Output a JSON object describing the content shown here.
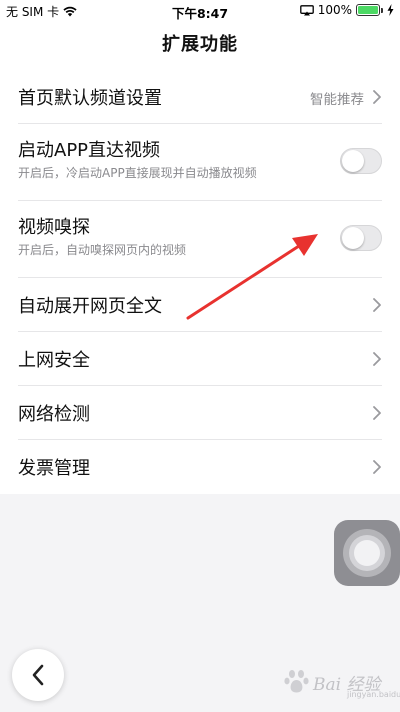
{
  "status_bar": {
    "carrier": "无 SIM 卡",
    "time": "下午8:47",
    "battery_percent": "100%",
    "battery_level": 1.0,
    "battery_color": "#4cd964"
  },
  "header": {
    "title": "扩展功能"
  },
  "settings": {
    "items": [
      {
        "title": "首页默认频道设置",
        "value": "智能推荐",
        "control": "chevron-right-icon"
      },
      {
        "title": "启动APP直达视频",
        "subtitle": "开启后，冷启动APP直接展现并自动播放视频",
        "control": "toggle",
        "enabled": false
      },
      {
        "title": "视频嗅探",
        "subtitle": "开启后，自动嗅探网页内的视频",
        "control": "toggle",
        "enabled": false
      },
      {
        "title": "自动展开网页全文",
        "control": "chevron-right-icon"
      },
      {
        "title": "上网安全",
        "control": "chevron-right-icon"
      },
      {
        "title": "网络检测",
        "control": "chevron-right-icon"
      },
      {
        "title": "发票管理",
        "control": "chevron-right-icon"
      }
    ]
  },
  "annotation": {
    "color": "#e8322f",
    "icon": "red-arrow-icon"
  },
  "floating": {
    "assistive_touch_icon": "assistive-touch-icon",
    "back_icon": "chevron-left-icon"
  },
  "watermark": {
    "text": "Bai 经验",
    "subtitle": "jingyan.baidu.com"
  }
}
